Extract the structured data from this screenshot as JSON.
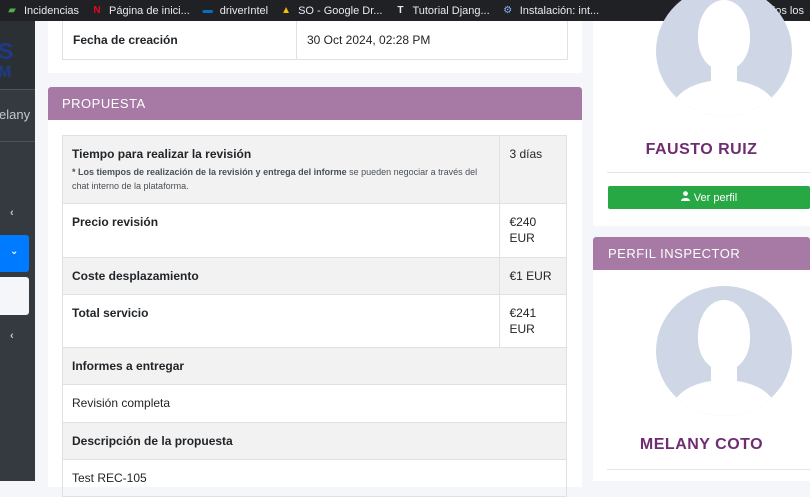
{
  "bookmarks": [
    {
      "label": "Incidencias",
      "icon": "incidencias-icon",
      "glyph": "▰",
      "color": "#4caf50"
    },
    {
      "label": "Página de inici...",
      "icon": "netflix-icon",
      "glyph": "N",
      "color": "#e50914"
    },
    {
      "label": "driverIntel",
      "icon": "intel-icon",
      "glyph": "▬",
      "color": "#0071c5"
    },
    {
      "label": "SO - Google Dr...",
      "icon": "google-drive-icon",
      "glyph": "▲",
      "color": "#fbbc04"
    },
    {
      "label": "Tutorial Djang...",
      "icon": "tutorial-icon",
      "glyph": "T",
      "color": "#e8eaed"
    },
    {
      "label": "Instalación: int...",
      "icon": "instalacion-icon",
      "glyph": "⚙",
      "color": "#8ab4f8"
    }
  ],
  "bookmarks_more": "»",
  "bookmarks_folder": "Todos los",
  "sidebar": {
    "brand_top": "S",
    "brand_bottom": "M",
    "user": "elany",
    "chevrons": [
      "‹",
      "⌄",
      "‹"
    ]
  },
  "top_row": {
    "label": "Fecha de creación",
    "value": "30 Oct 2024, 02:28 PM"
  },
  "propuesta": {
    "header": "PROPUESTA",
    "rows": [
      {
        "label": "Tiempo para realizar la revisión",
        "value": "3 días",
        "note_bold": "* Los tiempos de realización de la revisión y entrega del informe",
        "note_rest": " se pueden negociar a través del chat interno de la plataforma.",
        "alt": true
      },
      {
        "label": "Precio revisión",
        "value": "€240 EUR",
        "alt": false
      },
      {
        "label": "Coste desplazamiento",
        "value": "€1 EUR",
        "alt": true
      },
      {
        "label": "Total servicio",
        "value": "€241 EUR",
        "alt": false
      }
    ],
    "informes_label": "Informes a entregar",
    "informes_value": "Revisión completa",
    "descripcion_label": "Descripción de la propuesta",
    "descripcion_value": "Test REC-105"
  },
  "profile1": {
    "name": "FAUSTO RUIZ",
    "button": "Ver perfil",
    "button_icon": "user-icon"
  },
  "profile2": {
    "header": "PERFIL INSPECTOR",
    "name": "MELANY COTO"
  },
  "colors": {
    "header": "#a67aa5",
    "name": "#6f2c73",
    "button": "#28a745",
    "active_nav": "#007bff"
  }
}
